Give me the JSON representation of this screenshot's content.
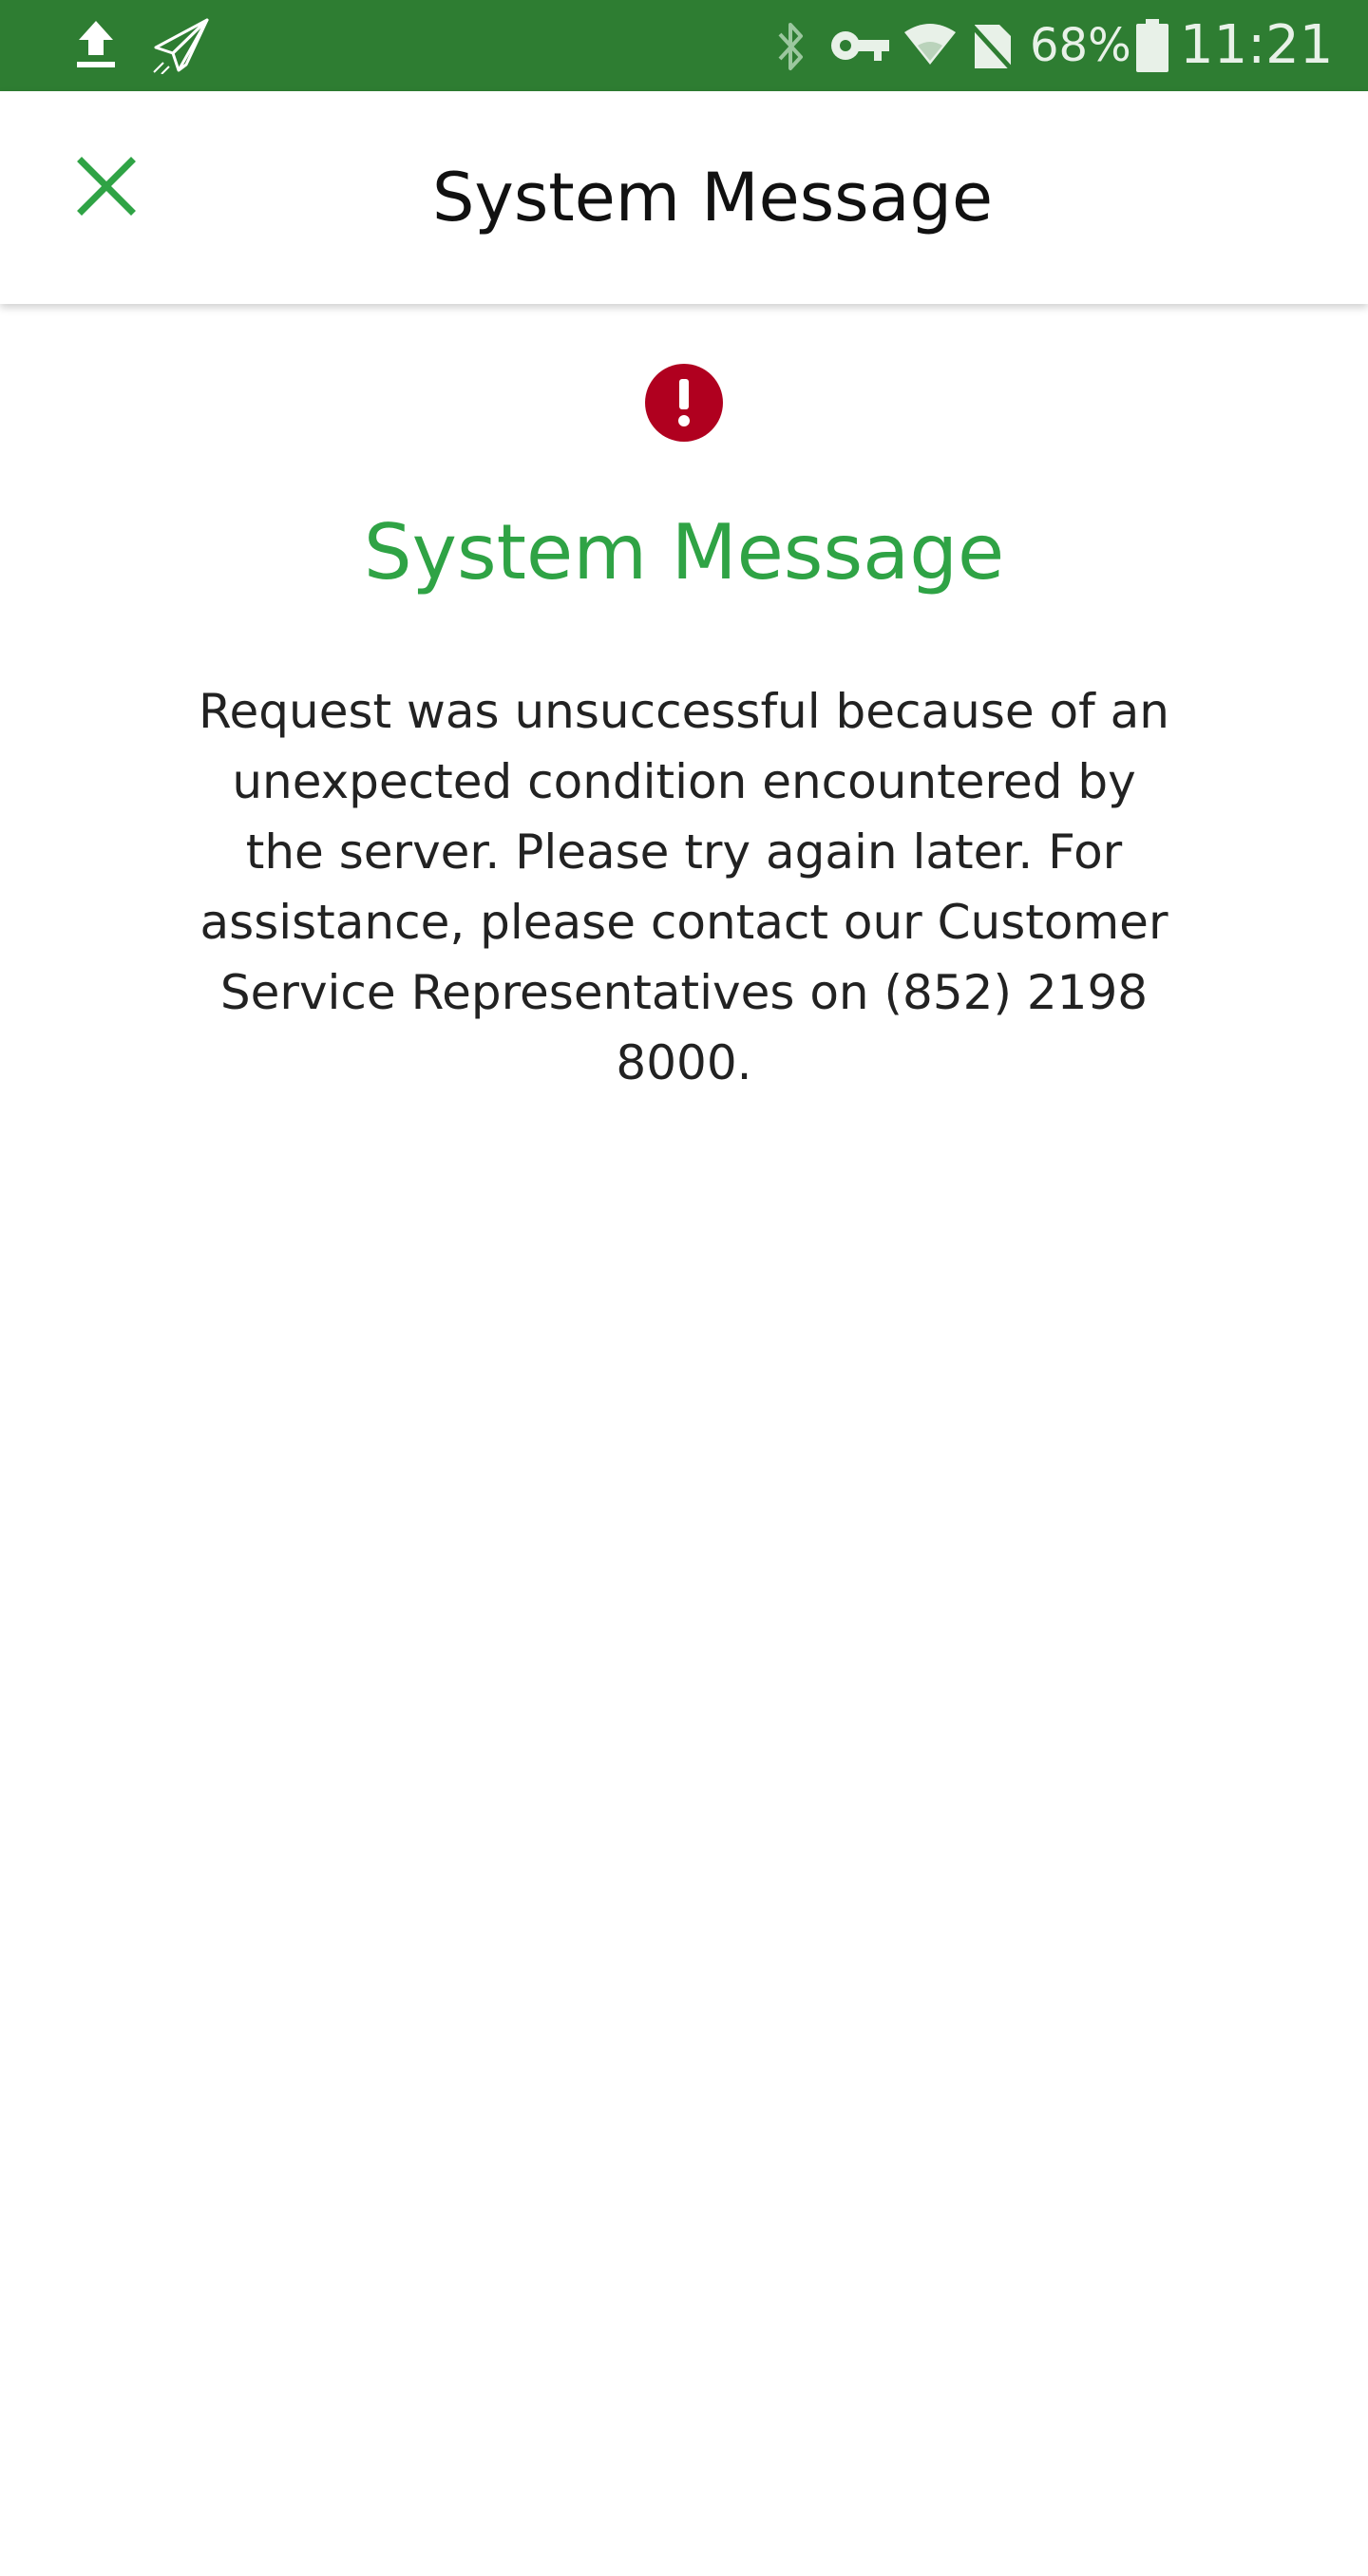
{
  "status_bar": {
    "battery_percent": "68%",
    "time": "11:21",
    "left_icons": [
      "upload-icon",
      "paper-plane-icon"
    ],
    "right_icons": [
      "bluetooth-icon",
      "vpn-key-icon",
      "wifi-icon",
      "no-sim-icon",
      "battery-icon"
    ]
  },
  "app_bar": {
    "title": "System Message",
    "close_icon": "close-icon"
  },
  "message": {
    "icon": "error-alert-icon",
    "title": "System Message",
    "body": "Request was unsuccessful because of an unexpected condition encountered by the server. Please try again later. For assistance, please contact our Customer Service Representatives on (852) 2198 8000."
  },
  "colors": {
    "status_bar": "#2e7d32",
    "accent_green": "#2fa345",
    "error_red": "#b0001f"
  }
}
